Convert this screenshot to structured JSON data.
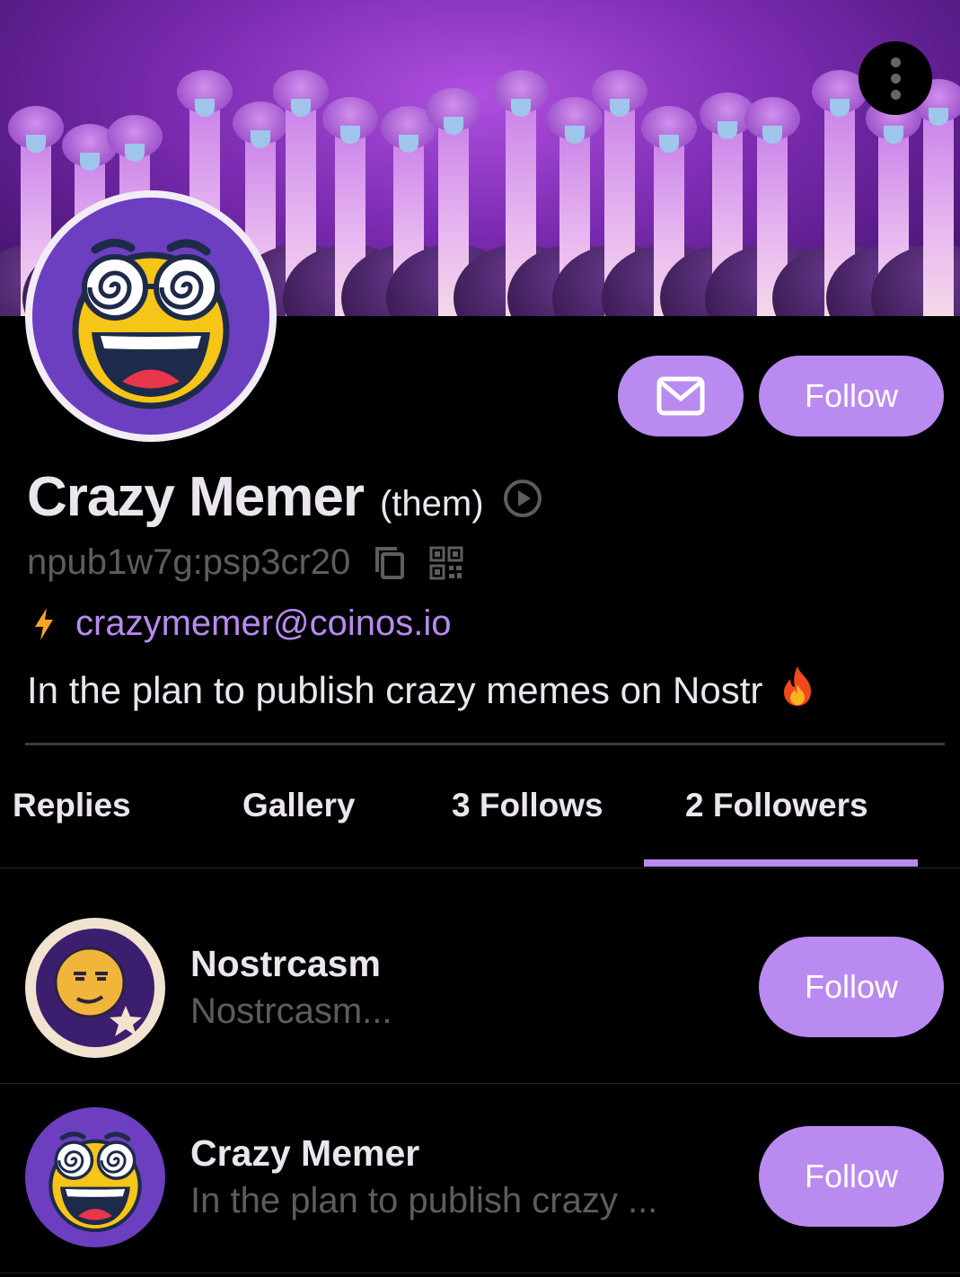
{
  "profile": {
    "name": "Crazy Memer",
    "pronoun": "(them)",
    "npub": "npub1w7g:psp3cr20",
    "lightning_address": "crazymemer@coinos.io",
    "bio": "In the plan to publish crazy memes on Nostr",
    "bio_emoji": "🔥",
    "follow_label": "Follow"
  },
  "icons": {
    "menu": "more-vertical-icon",
    "message": "mail-icon",
    "play": "play-circle-icon",
    "copy": "copy-icon",
    "qr": "qr-code-icon",
    "lightning": "lightning-icon"
  },
  "tabs": [
    {
      "label": "Replies"
    },
    {
      "label": "Gallery"
    },
    {
      "label": "3 Follows"
    },
    {
      "label": "2  Followers",
      "active": true
    }
  ],
  "followers": [
    {
      "name": "Nostrcasm",
      "subtitle": "Nostrcasm...",
      "follow_label": "Follow"
    },
    {
      "name": "Crazy Memer",
      "subtitle": "In the plan to publish crazy ...",
      "follow_label": "Follow"
    }
  ],
  "colors": {
    "accent": "#b98af0",
    "background": "#000000",
    "muted_text": "#5d5d5d",
    "lightning": "#f5a623"
  }
}
